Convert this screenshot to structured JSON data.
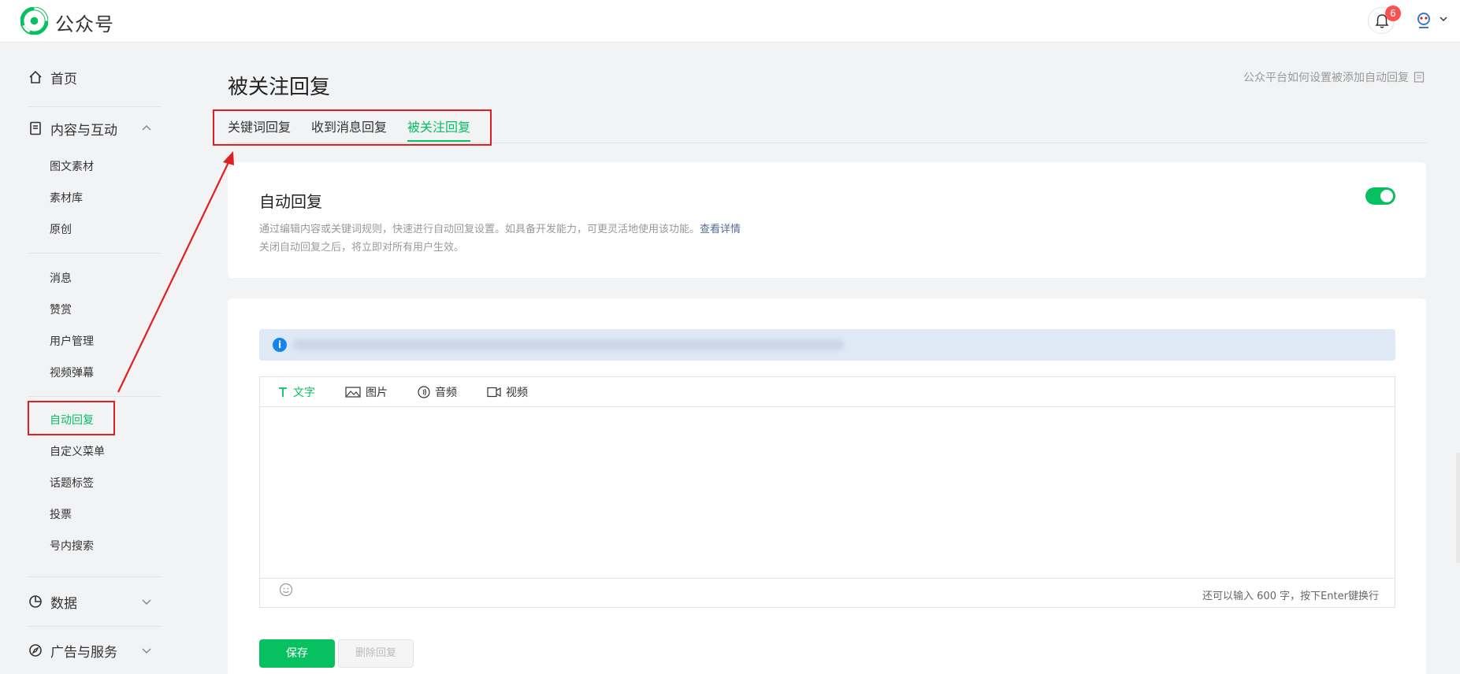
{
  "app": {
    "brand": "公众号",
    "notification_count": "6"
  },
  "sidebar": {
    "home": "首页",
    "content": "内容与互动",
    "content_items": [
      "图文素材",
      "素材库",
      "原创"
    ],
    "interact_items": [
      "消息",
      "赞赏",
      "用户管理",
      "视频弹幕"
    ],
    "feature_items": [
      "自动回复",
      "自定义菜单",
      "话题标签",
      "投票",
      "号内搜索"
    ],
    "data": "数据",
    "ads": "广告与服务",
    "active_item": "自动回复"
  },
  "main": {
    "title": "被关注回复",
    "help_link": "公众平台如何设置被添加自动回复",
    "tabs": [
      {
        "label": "关键词回复",
        "active": false
      },
      {
        "label": "收到消息回复",
        "active": false
      },
      {
        "label": "被关注回复",
        "active": true
      }
    ],
    "auto_reply": {
      "heading": "自动回复",
      "desc_line1": "通过编辑内容或关键词规则，快速进行自动回复设置。如具备开发能力，可更灵活地使用该功能。",
      "details_link": "查看详情",
      "desc_line2": "关闭自动回复之后，将立即对所有用户生效。",
      "enabled": true
    },
    "editor": {
      "tools": [
        {
          "label": "文字",
          "icon": "text-icon",
          "active": true
        },
        {
          "label": "图片",
          "icon": "image-icon",
          "active": false
        },
        {
          "label": "音频",
          "icon": "audio-icon",
          "active": false
        },
        {
          "label": "视频",
          "icon": "video-icon",
          "active": false
        }
      ],
      "counter": "还可以输入 600 字，按下Enter键换行"
    },
    "buttons": {
      "save": "保存",
      "delete": "删除回复"
    }
  },
  "colors": {
    "accent": "#07c160",
    "annotation": "#e02020",
    "link": "#576b95",
    "notice_bg": "#dfe9f5"
  }
}
